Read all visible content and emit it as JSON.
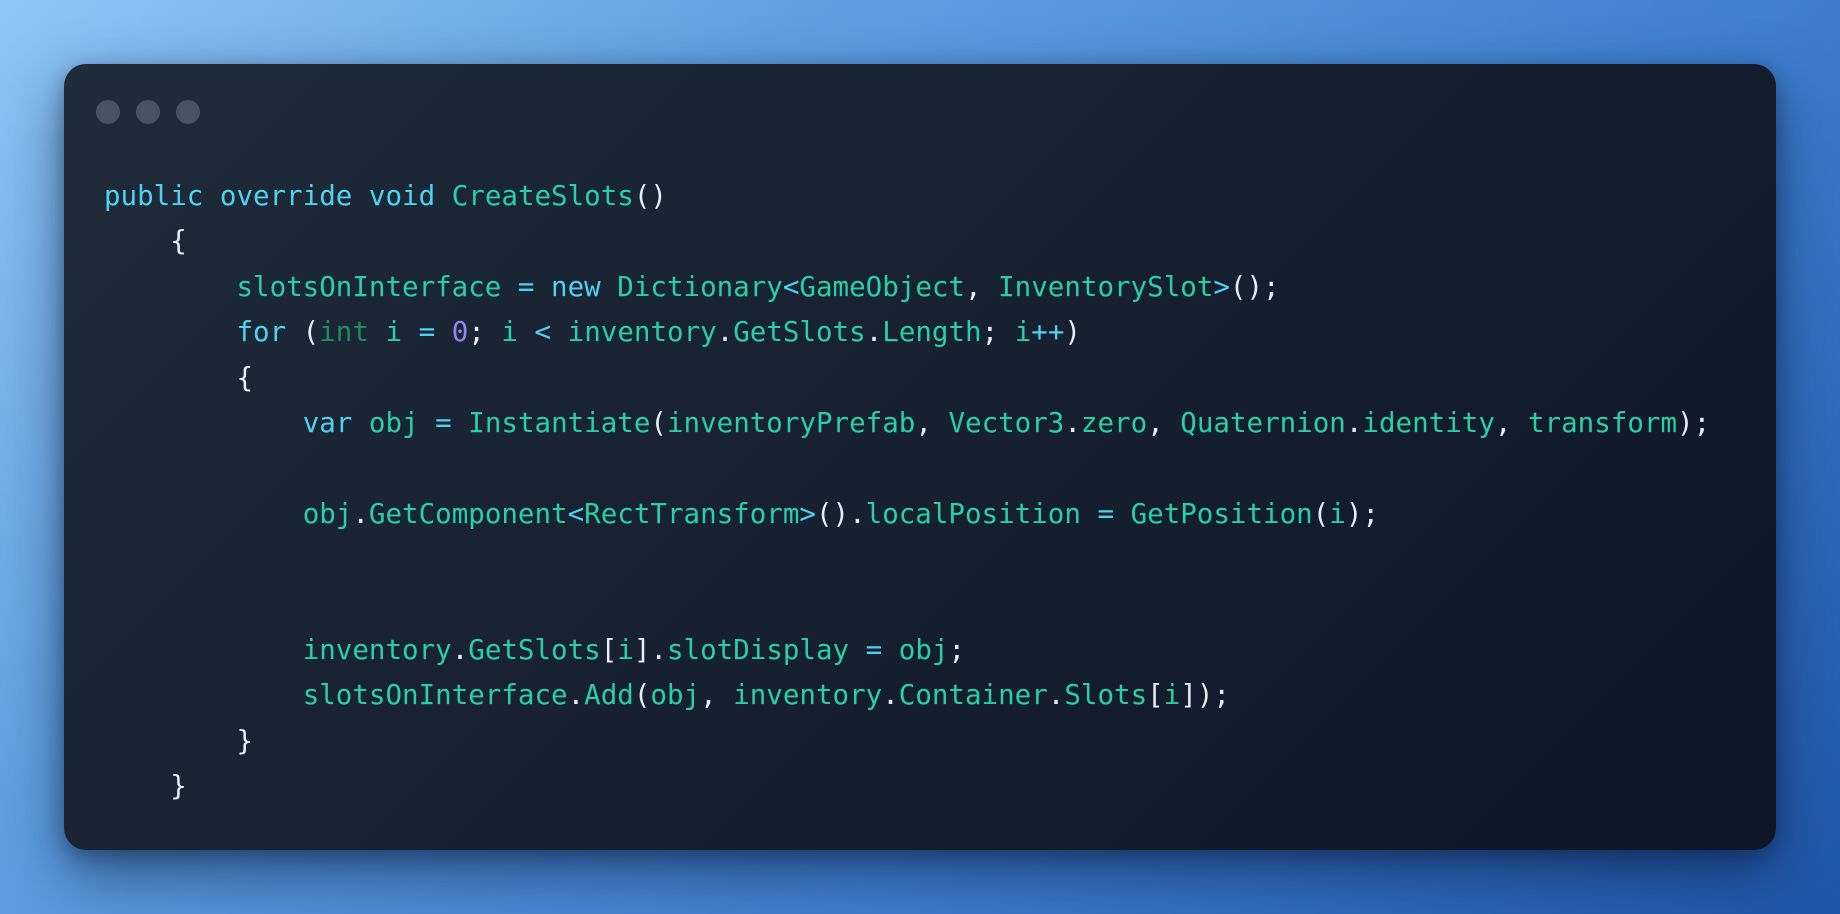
{
  "window": {
    "controls": [
      {
        "icon": "window-dot-icon",
        "color": "#4a5260"
      },
      {
        "icon": "window-dot-icon",
        "color": "#4a5260"
      },
      {
        "icon": "window-dot-icon",
        "color": "#4a5260"
      }
    ]
  },
  "colors": {
    "keyword": "#4fd2f2",
    "identifier": "#29cfa5",
    "type_int": "#1d8a62",
    "number": "#9a84f0",
    "punctuation": "#e8eef5",
    "window_bg": "#17212f"
  },
  "code": {
    "language": "C#",
    "lines": [
      [
        [
          "kw",
          "public"
        ],
        [
          "pn",
          " "
        ],
        [
          "kw",
          "override"
        ],
        [
          "pn",
          " "
        ],
        [
          "kw",
          "void"
        ],
        [
          "pn",
          " "
        ],
        [
          "id",
          "CreateSlots"
        ],
        [
          "pn",
          "()"
        ]
      ],
      [
        [
          "pn",
          "    {"
        ]
      ],
      [
        [
          "pn",
          "        "
        ],
        [
          "id",
          "slotsOnInterface"
        ],
        [
          "pn",
          " "
        ],
        [
          "kw",
          "="
        ],
        [
          "pn",
          " "
        ],
        [
          "kw",
          "new"
        ],
        [
          "pn",
          " "
        ],
        [
          "id",
          "Dictionary"
        ],
        [
          "kw",
          "<"
        ],
        [
          "id",
          "GameObject"
        ],
        [
          "pn",
          ", "
        ],
        [
          "id",
          "InventorySlot"
        ],
        [
          "kw",
          ">"
        ],
        [
          "pn",
          "();"
        ]
      ],
      [
        [
          "pn",
          "        "
        ],
        [
          "kw",
          "for"
        ],
        [
          "pn",
          " ("
        ],
        [
          "tint",
          "int"
        ],
        [
          "pn",
          " "
        ],
        [
          "id",
          "i"
        ],
        [
          "pn",
          " "
        ],
        [
          "kw",
          "="
        ],
        [
          "pn",
          " "
        ],
        [
          "num",
          "0"
        ],
        [
          "pn",
          "; "
        ],
        [
          "id",
          "i"
        ],
        [
          "pn",
          " "
        ],
        [
          "kw",
          "<"
        ],
        [
          "pn",
          " "
        ],
        [
          "id",
          "inventory"
        ],
        [
          "pn",
          "."
        ],
        [
          "id",
          "GetSlots"
        ],
        [
          "pn",
          "."
        ],
        [
          "id",
          "Length"
        ],
        [
          "pn",
          "; "
        ],
        [
          "id",
          "i"
        ],
        [
          "kw",
          "++"
        ],
        [
          "pn",
          ")"
        ]
      ],
      [
        [
          "pn",
          "        {"
        ]
      ],
      [
        [
          "pn",
          "            "
        ],
        [
          "kw",
          "var"
        ],
        [
          "pn",
          " "
        ],
        [
          "id",
          "obj"
        ],
        [
          "pn",
          " "
        ],
        [
          "kw",
          "="
        ],
        [
          "pn",
          " "
        ],
        [
          "id",
          "Instantiate"
        ],
        [
          "pn",
          "("
        ],
        [
          "id",
          "inventoryPrefab"
        ],
        [
          "pn",
          ", "
        ],
        [
          "id",
          "Vector3"
        ],
        [
          "pn",
          "."
        ],
        [
          "id",
          "zero"
        ],
        [
          "pn",
          ", "
        ],
        [
          "id",
          "Quaternion"
        ],
        [
          "pn",
          "."
        ],
        [
          "id",
          "identity"
        ],
        [
          "pn",
          ", "
        ],
        [
          "id",
          "transform"
        ],
        [
          "pn",
          ");"
        ]
      ],
      [],
      [
        [
          "pn",
          "            "
        ],
        [
          "id",
          "obj"
        ],
        [
          "pn",
          "."
        ],
        [
          "id",
          "GetComponent"
        ],
        [
          "kw",
          "<"
        ],
        [
          "id",
          "RectTransform"
        ],
        [
          "kw",
          ">"
        ],
        [
          "pn",
          "()."
        ],
        [
          "id",
          "localPosition"
        ],
        [
          "pn",
          " "
        ],
        [
          "kw",
          "="
        ],
        [
          "pn",
          " "
        ],
        [
          "id",
          "GetPosition"
        ],
        [
          "pn",
          "("
        ],
        [
          "id",
          "i"
        ],
        [
          "pn",
          ");"
        ]
      ],
      [],
      [],
      [
        [
          "pn",
          "            "
        ],
        [
          "id",
          "inventory"
        ],
        [
          "pn",
          "."
        ],
        [
          "id",
          "GetSlots"
        ],
        [
          "pn",
          "["
        ],
        [
          "id",
          "i"
        ],
        [
          "pn",
          "]."
        ],
        [
          "id",
          "slotDisplay"
        ],
        [
          "pn",
          " "
        ],
        [
          "kw",
          "="
        ],
        [
          "pn",
          " "
        ],
        [
          "id",
          "obj"
        ],
        [
          "pn",
          ";"
        ]
      ],
      [
        [
          "pn",
          "            "
        ],
        [
          "id",
          "slotsOnInterface"
        ],
        [
          "pn",
          "."
        ],
        [
          "id",
          "Add"
        ],
        [
          "pn",
          "("
        ],
        [
          "id",
          "obj"
        ],
        [
          "pn",
          ", "
        ],
        [
          "id",
          "inventory"
        ],
        [
          "pn",
          "."
        ],
        [
          "id",
          "Container"
        ],
        [
          "pn",
          "."
        ],
        [
          "id",
          "Slots"
        ],
        [
          "pn",
          "["
        ],
        [
          "id",
          "i"
        ],
        [
          "pn",
          "]);"
        ]
      ],
      [
        [
          "pn",
          "        }"
        ]
      ],
      [
        [
          "pn",
          "    }"
        ]
      ]
    ]
  }
}
